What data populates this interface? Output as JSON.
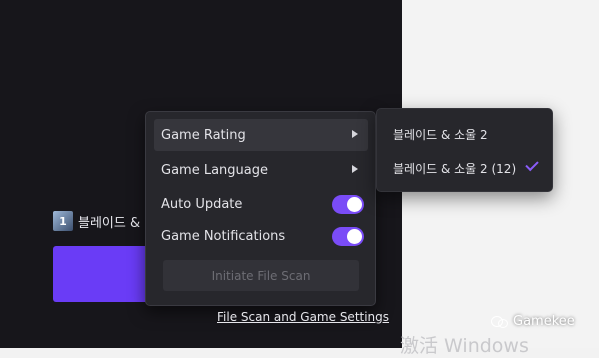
{
  "game": {
    "icon_text": "1",
    "name_partial": "블레이드 &"
  },
  "menu": {
    "items": [
      {
        "label": "Game Rating",
        "type": "submenu"
      },
      {
        "label": "Game Language",
        "type": "submenu"
      },
      {
        "label": "Auto Update",
        "type": "toggle",
        "on": true
      },
      {
        "label": "Game Notifications",
        "type": "toggle",
        "on": true
      }
    ],
    "scan_button": "Initiate File Scan"
  },
  "submenu": {
    "items": [
      {
        "label": "블레이드 & 소울 2",
        "selected": false
      },
      {
        "label": "블레이드 & 소울 2 (12)",
        "selected": true
      }
    ]
  },
  "footer": {
    "settings_link": "File Scan and Game Settings",
    "watermark": "激活 Windows",
    "brand": "Gamekee"
  },
  "colors": {
    "accent": "#6a3cf6",
    "toggle": "#7a4cf7",
    "menu_bg": "#27272c",
    "left_bg": "#17161b"
  }
}
